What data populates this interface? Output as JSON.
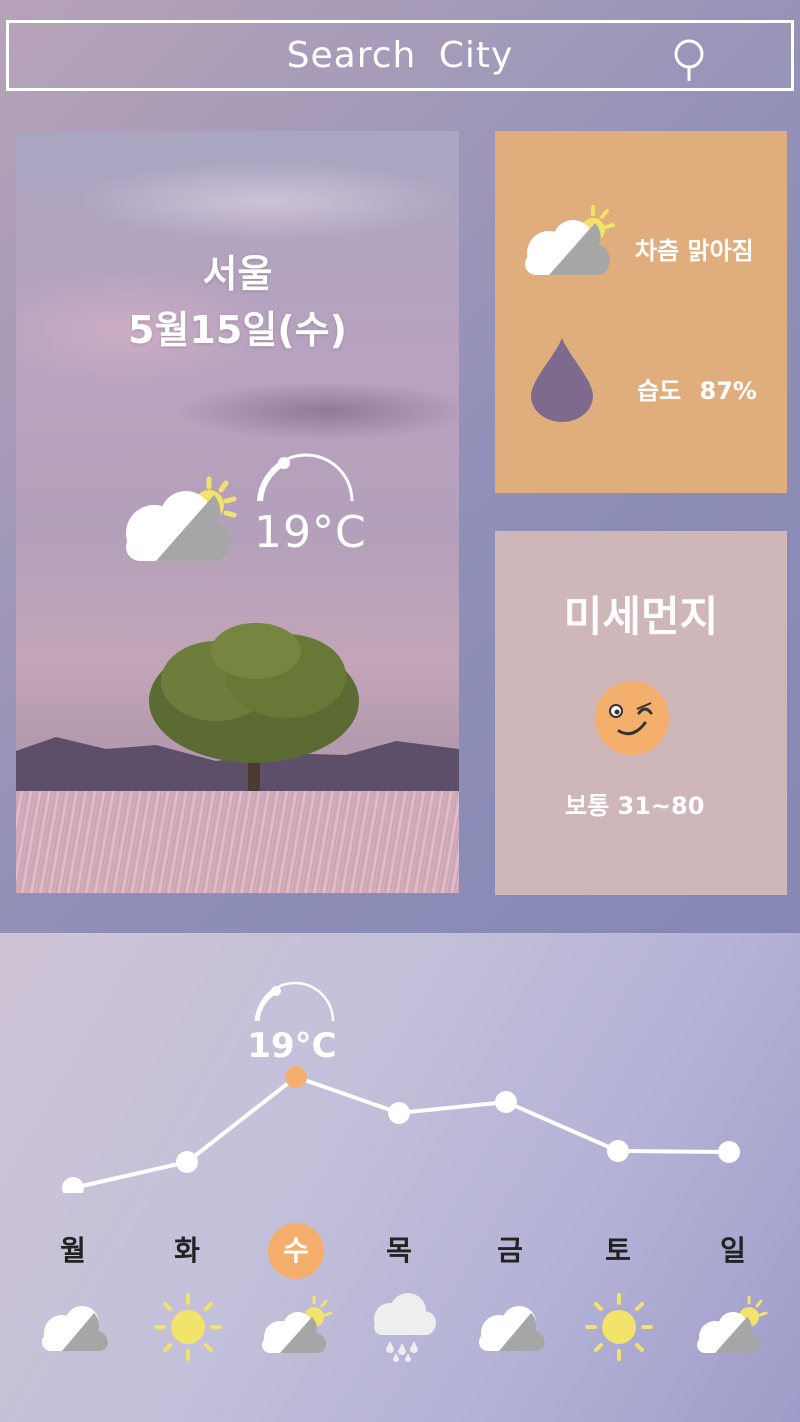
{
  "search": {
    "label": "Search City"
  },
  "current": {
    "city": "서울",
    "date": "5월15일(수)",
    "temperature": "19°C",
    "icon": "partly-cloudy-icon"
  },
  "forecast_card": {
    "condition": "차츰 맑아짐",
    "condition_icon": "partly-cloudy-icon",
    "humidity_text": "습도 87%",
    "humidity_icon": "water-drop-icon",
    "humidity_value": 87
  },
  "dust_card": {
    "title": "미세먼지",
    "status": "보통 31~80",
    "face_icon": "wink-face-icon"
  },
  "weekly": {
    "selected_temp": "19°C",
    "days": [
      {
        "label": "월",
        "icon": "cloudy-icon",
        "active": false
      },
      {
        "label": "화",
        "icon": "sunny-icon",
        "active": false
      },
      {
        "label": "수",
        "icon": "partly-cloudy-icon",
        "active": true
      },
      {
        "label": "목",
        "icon": "rainy-cloud-icon",
        "active": false
      },
      {
        "label": "금",
        "icon": "cloudy-icon",
        "active": false
      },
      {
        "label": "토",
        "icon": "sunny-icon",
        "active": false
      },
      {
        "label": "일",
        "icon": "partly-cloudy-icon",
        "active": false
      }
    ]
  },
  "colors": {
    "accent_orange": "#f4af6d",
    "forecast_card_bg": "#e0ae7c",
    "dust_card_bg": "#cfb6b9",
    "drop_color": "#7e6a8c",
    "sun_yellow": "#f2e36a"
  }
}
